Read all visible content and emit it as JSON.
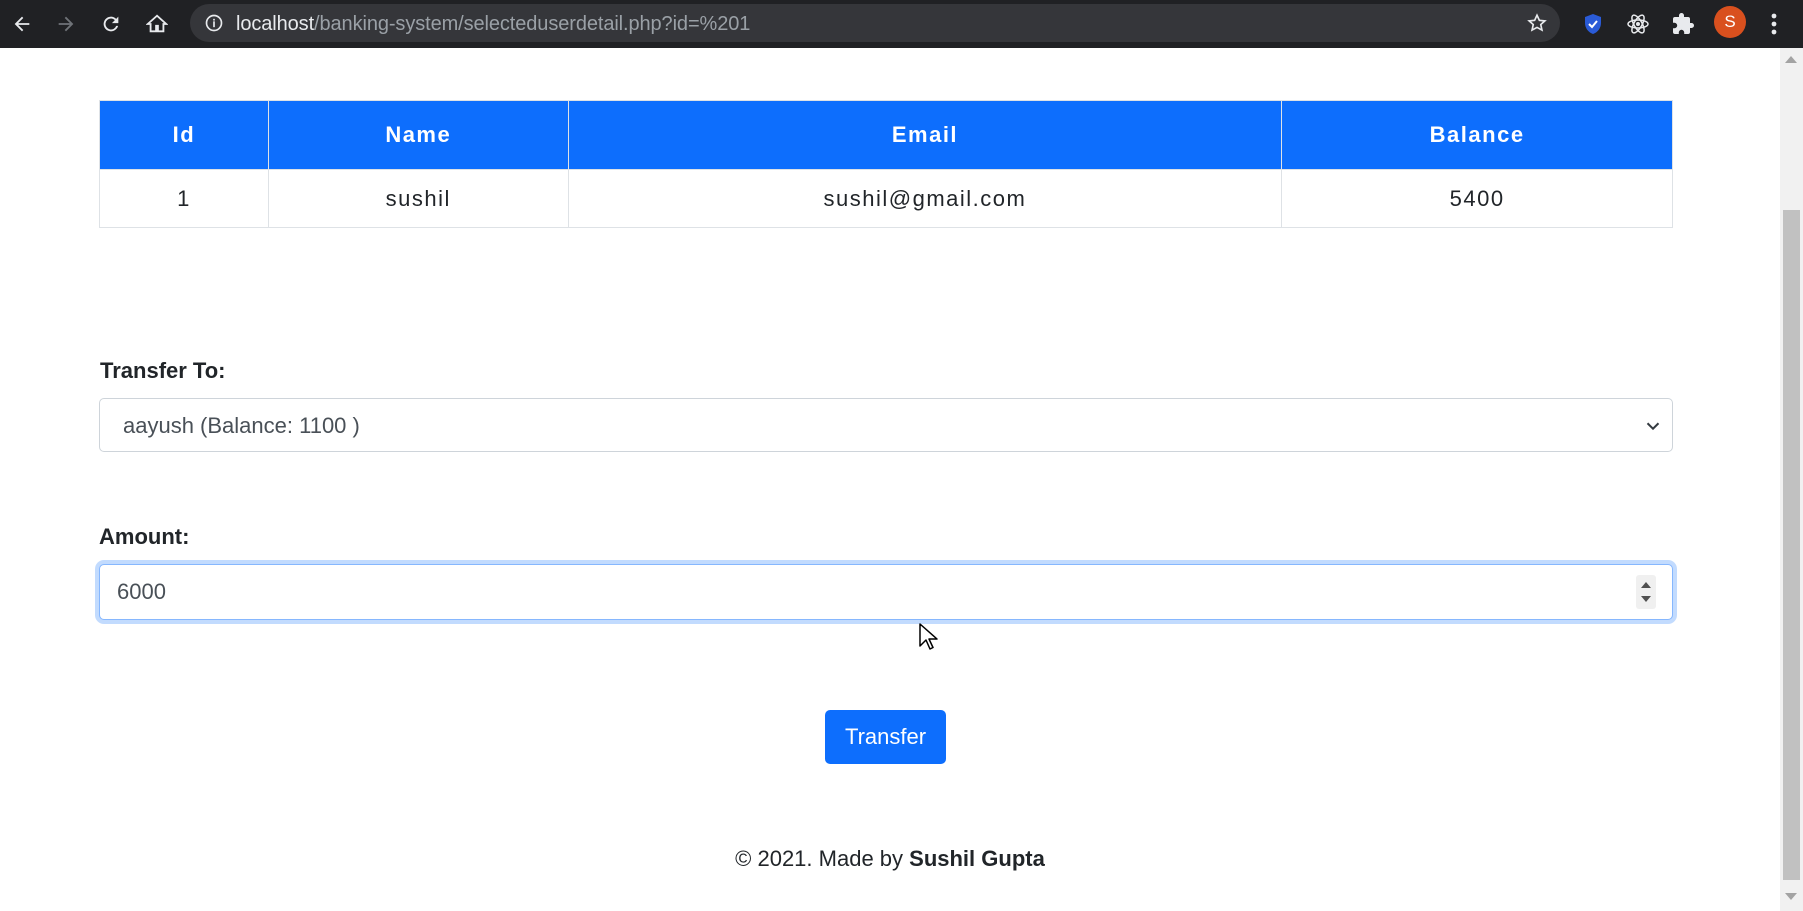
{
  "browser": {
    "url_host": "localhost",
    "url_path": "/banking-system/selecteduserdetail.php?id=%201",
    "profile_initial": "S"
  },
  "table": {
    "headers": [
      "Id",
      "Name",
      "Email",
      "Balance"
    ],
    "rows": [
      [
        "1",
        "sushil",
        "sushil@gmail.com",
        "5400"
      ]
    ]
  },
  "form": {
    "transfer_to_label": "Transfer To:",
    "transfer_to_value": "aayush (Balance: 1100 )",
    "amount_label": "Amount:",
    "amount_value": "6000",
    "submit_label": "Transfer"
  },
  "footer": {
    "prefix": "© 2021. Made by ",
    "author": "Sushil Gupta"
  },
  "colors": {
    "primary": "#0d6efd",
    "chrome_bg": "#202124",
    "omnibox_bg": "#35363a"
  }
}
